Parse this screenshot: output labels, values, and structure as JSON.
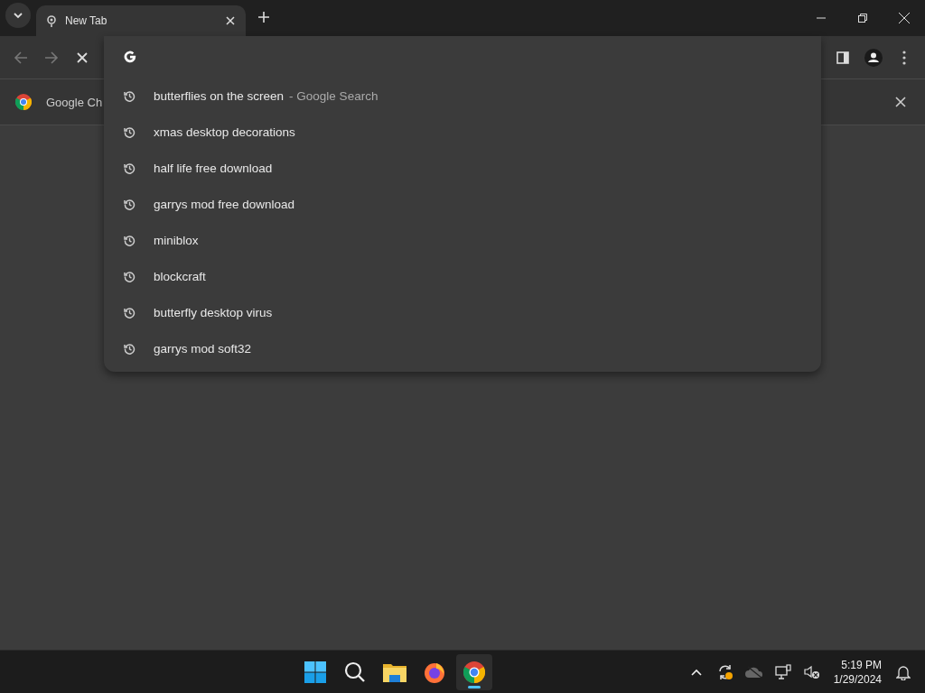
{
  "tabs": [
    {
      "title": "New Tab",
      "selected": true
    }
  ],
  "infobar": {
    "text": "Google Ch"
  },
  "omnibox": {
    "suggestions": [
      {
        "text": "butterflies on the screen",
        "suffix": "- Google Search"
      },
      {
        "text": "xmas desktop decorations"
      },
      {
        "text": "half life free download"
      },
      {
        "text": "garrys mod free download"
      },
      {
        "text": "miniblox"
      },
      {
        "text": "blockcraft"
      },
      {
        "text": "butterfly desktop virus"
      },
      {
        "text": "garrys mod soft32"
      }
    ]
  },
  "taskbar": {
    "apps": [
      {
        "kind": "start",
        "active": false
      },
      {
        "kind": "search",
        "active": false
      },
      {
        "kind": "files",
        "active": false
      },
      {
        "kind": "firefox",
        "active": false
      },
      {
        "kind": "chrome",
        "active": true
      }
    ],
    "time": "5:19 PM",
    "date": "1/29/2024"
  }
}
